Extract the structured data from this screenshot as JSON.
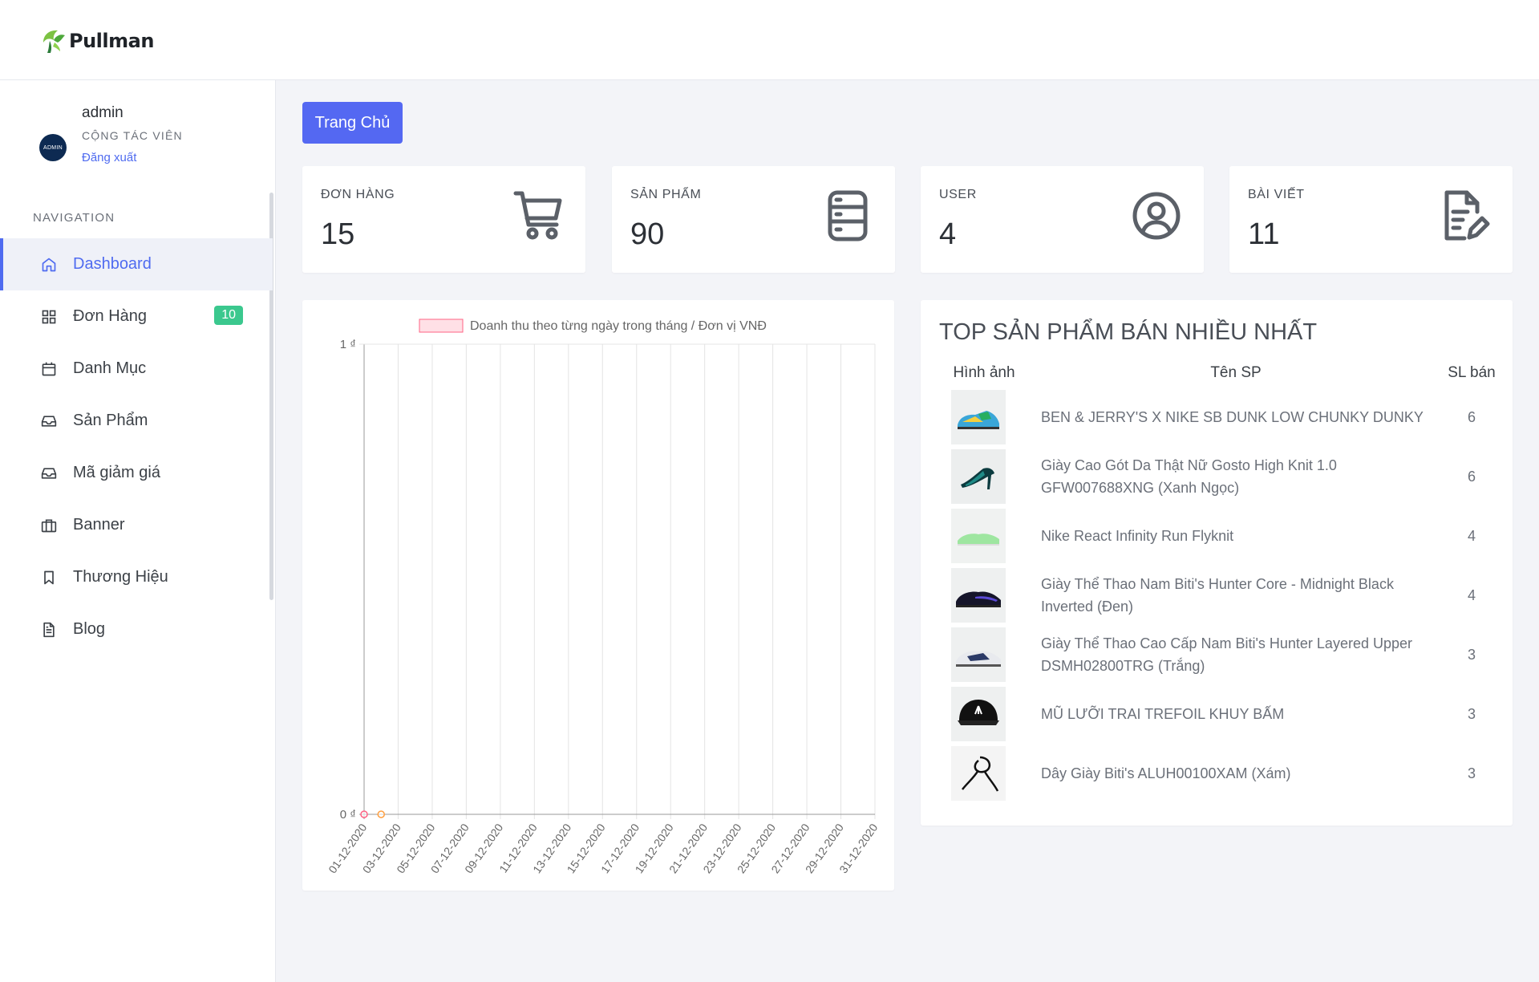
{
  "brand": {
    "name": "Pullman"
  },
  "user": {
    "name": "admin",
    "role": "CỘNG TÁC VIÊN",
    "logout": "Đăng xuất",
    "avatar_text": "ADMIN"
  },
  "nav": {
    "heading": "NAVIGATION",
    "items": [
      {
        "label": "Dashboard",
        "icon": "home-icon",
        "active": true
      },
      {
        "label": "Đơn Hàng",
        "icon": "grid-icon",
        "badge": "10"
      },
      {
        "label": "Danh Mục",
        "icon": "calendar-icon"
      },
      {
        "label": "Sản Phẩm",
        "icon": "inbox-icon"
      },
      {
        "label": "Mã giảm giá",
        "icon": "inbox-icon"
      },
      {
        "label": "Banner",
        "icon": "briefcase-icon"
      },
      {
        "label": "Thương Hiệu",
        "icon": "bookmark-icon"
      },
      {
        "label": "Blog",
        "icon": "file-text-icon"
      }
    ]
  },
  "header": {
    "home_button": "Trang Chủ"
  },
  "stats": [
    {
      "label": "ĐƠN HÀNG",
      "value": "15",
      "icon": "cart-icon"
    },
    {
      "label": "SẢN PHẨM",
      "value": "90",
      "icon": "database-icon"
    },
    {
      "label": "USER",
      "value": "4",
      "icon": "user-circle-icon"
    },
    {
      "label": "BÀI VIẾT",
      "value": "11",
      "icon": "file-edit-icon"
    }
  ],
  "top_products": {
    "title": "TOP SẢN PHẨM BÁN NHIỀU NHẤT",
    "columns": [
      "Hình ảnh",
      "Tên SP",
      "SL bán"
    ],
    "rows": [
      {
        "name": "BEN & JERRY'S X NIKE SB DUNK LOW CHUNKY DUNKY",
        "qty": "6",
        "image": "sneaker-multicolor"
      },
      {
        "name": "Giày Cao Gót Da Thật Nữ Gosto High Knit 1.0 GFW007688XNG (Xanh Ngọc)",
        "qty": "6",
        "image": "high-heel-teal"
      },
      {
        "name": "Nike React Infinity Run Flyknit",
        "qty": "4",
        "image": "sneaker-green"
      },
      {
        "name": "Giày Thể Thao Nam Biti's Hunter Core - Midnight Black Inverted (Đen)",
        "qty": "4",
        "image": "sneaker-black"
      },
      {
        "name": "Giày Thể Thao Cao Cấp Nam Biti's Hunter Layered Upper DSMH02800TRG (Trắng)",
        "qty": "3",
        "image": "sneaker-white"
      },
      {
        "name": "MŨ LƯỠI TRAI TREFOIL KHUY BẤM",
        "qty": "3",
        "image": "cap-black"
      },
      {
        "name": "Dây Giày Biti's ALUH00100XAM (Xám)",
        "qty": "3",
        "image": "shoelace-black"
      }
    ]
  },
  "chart_data": {
    "type": "line",
    "legend": "Doanh thu theo từng ngày trong tháng / Đơn vị VNĐ",
    "legend_color": "#ff6384",
    "legend_placement": "top",
    "x": [
      "01-12-2020",
      "02-12-2020",
      "03-12-2020",
      "04-12-2020",
      "05-12-2020",
      "06-12-2020",
      "07-12-2020",
      "08-12-2020",
      "09-12-2020",
      "10-12-2020",
      "11-12-2020",
      "12-12-2020",
      "13-12-2020",
      "14-12-2020",
      "15-12-2020",
      "16-12-2020",
      "17-12-2020",
      "18-12-2020",
      "19-12-2020",
      "20-12-2020",
      "21-12-2020",
      "22-12-2020",
      "23-12-2020",
      "24-12-2020",
      "25-12-2020",
      "26-12-2020",
      "27-12-2020",
      "28-12-2020",
      "29-12-2020",
      "30-12-2020",
      "31-12-2020"
    ],
    "tick_labels": [
      "01-12-2020",
      "03-12-2020",
      "05-12-2020",
      "07-12-2020",
      "09-12-2020",
      "11-12-2020",
      "13-12-2020",
      "15-12-2020",
      "17-12-2020",
      "19-12-2020",
      "21-12-2020",
      "23-12-2020",
      "25-12-2020",
      "27-12-2020",
      "29-12-2020",
      "31-12-2020"
    ],
    "points": [
      {
        "x": "01-12-2020",
        "y": 0,
        "color": "#ff6384"
      },
      {
        "x": "02-12-2020",
        "y": 0,
        "color": "#ff9f40"
      }
    ],
    "y_ticks": [
      "0 ₫",
      "1 ₫"
    ],
    "ylim": [
      0,
      1
    ],
    "grid": true
  }
}
